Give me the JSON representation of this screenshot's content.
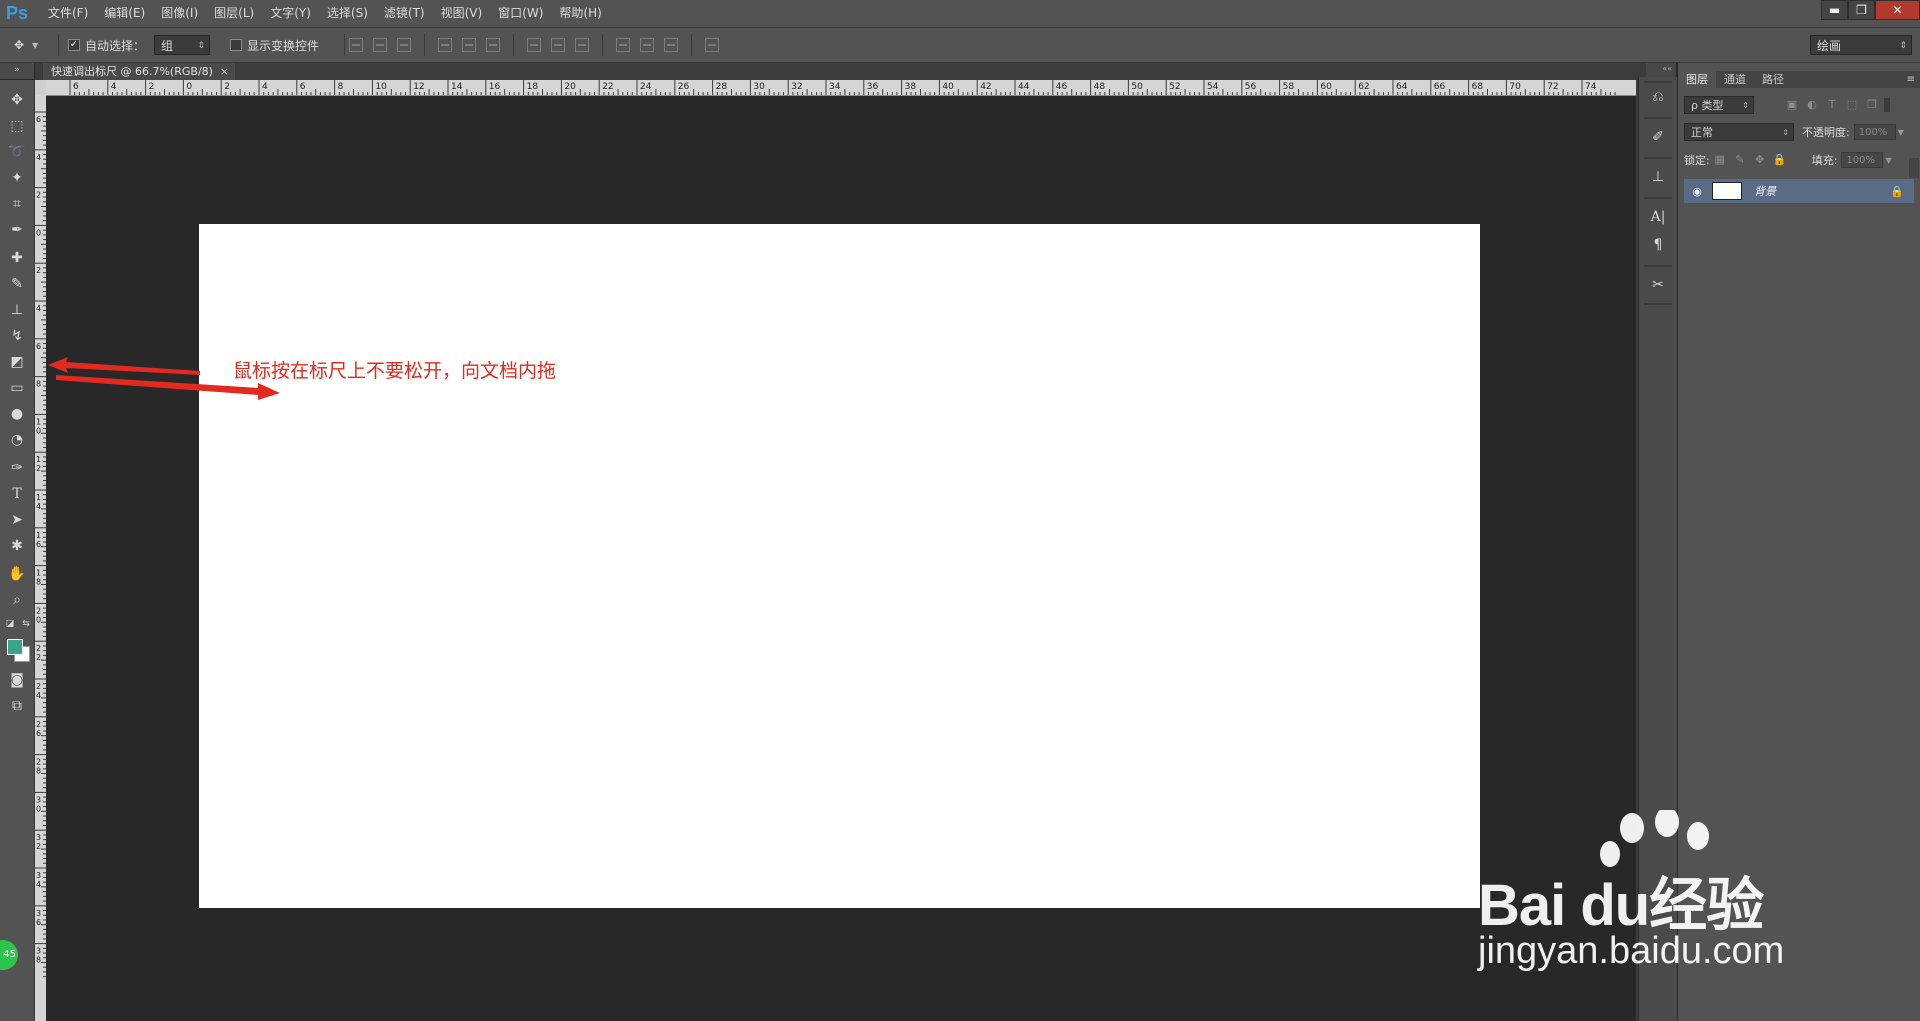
{
  "app": {
    "logo": "Ps",
    "menu": [
      "文件(F)",
      "编辑(E)",
      "图像(I)",
      "图层(L)",
      "文字(Y)",
      "选择(S)",
      "滤镜(T)",
      "视图(V)",
      "窗口(W)",
      "帮助(H)"
    ],
    "window_controls": {
      "minimize": "▬",
      "restore": "❐",
      "close": "✕"
    }
  },
  "options": {
    "auto_select_label": "自动选择：",
    "auto_select_checked": "✓",
    "auto_select_value": "组",
    "show_transform_label": "显示变换控件",
    "workspace": "绘画"
  },
  "document": {
    "tab_title": "快速调出标尺 @ 66.7%(RGB/8)",
    "tab_close": "×",
    "annotation": "鼠标按在标尺上不要松开，向文档内拖",
    "annotation_color": "#e22a20"
  },
  "rulers": {
    "top_labels": [
      "6",
      "4",
      "2",
      "0",
      "2",
      "4",
      "6",
      "8",
      "10",
      "12",
      "14",
      "16",
      "18",
      "20",
      "22",
      "24",
      "26",
      "28",
      "30",
      "32",
      "34",
      "36",
      "38",
      "40",
      "42",
      "44",
      "46",
      "48",
      "50",
      "52",
      "54",
      "56",
      "58",
      "60",
      "62",
      "64",
      "66",
      "68",
      "70",
      "72",
      "74"
    ],
    "left_labels": [
      "6",
      "4",
      "2",
      "0",
      "2",
      "4",
      "6",
      "8",
      "10",
      "12",
      "14",
      "16",
      "18",
      "20",
      "22",
      "24",
      "26",
      "28",
      "30",
      "32",
      "34",
      "36",
      "38"
    ]
  },
  "layers_panel": {
    "tabs": [
      "图层",
      "通道",
      "路径"
    ],
    "menu_icon": "≡",
    "filter_label": "ρ 类型",
    "blend_mode": "正常",
    "opacity_label": "不透明度:",
    "opacity_value": "100%",
    "lock_label": "锁定:",
    "fill_label": "填充:",
    "fill_value": "100%",
    "layer_name": "背景",
    "layer_eye": "◉",
    "layer_lock": "🔒"
  },
  "toolbar": {
    "badge": "45",
    "fg_color": "#3aa48a",
    "bg_color": "#ffffff"
  },
  "watermark": {
    "brand": "Bai du经验",
    "site": "jingyan.baidu.com"
  }
}
